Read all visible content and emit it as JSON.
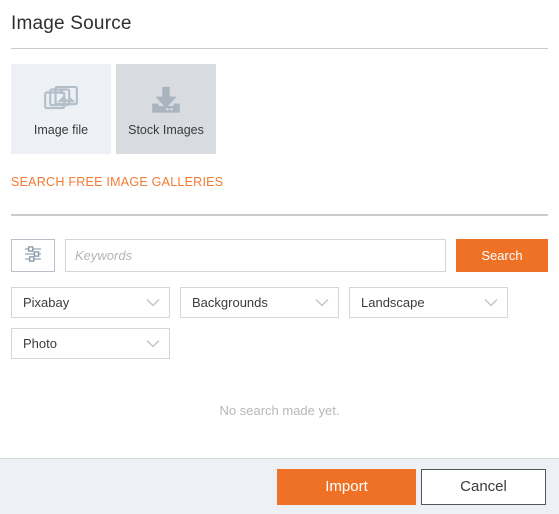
{
  "dialog": {
    "title": "Image Source"
  },
  "sources": {
    "tiles": [
      {
        "label": "Image file",
        "icon": "images-stack-icon",
        "selected": false
      },
      {
        "label": "Stock Images",
        "icon": "download-icon",
        "selected": true
      }
    ]
  },
  "gallery_link": {
    "label": "SEARCH FREE IMAGE GALLERIES",
    "color": "#f47b34"
  },
  "search": {
    "filter_icon": "sliders-filter-icon",
    "keywords_value": "",
    "keywords_placeholder": "Keywords",
    "search_label": "Search"
  },
  "filters": [
    {
      "name": "provider",
      "value": "Pixabay"
    },
    {
      "name": "category",
      "value": "Backgrounds"
    },
    {
      "name": "orientation",
      "value": "Landscape"
    },
    {
      "name": "media-type",
      "value": "Photo"
    }
  ],
  "results": {
    "status": "No search made yet."
  },
  "footer": {
    "import_label": "Import",
    "cancel_label": "Cancel",
    "primary_color": "#ef7125"
  }
}
